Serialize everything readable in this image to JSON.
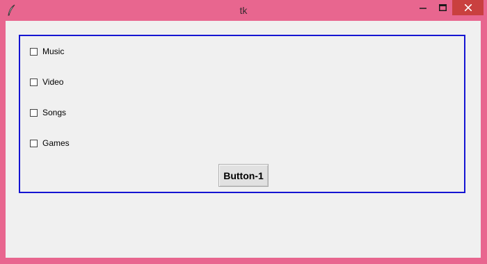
{
  "window": {
    "title": "tk",
    "icons": {
      "app": "feather-icon",
      "minimize": "minimize-icon",
      "maximize": "maximize-icon",
      "close": "close-icon"
    },
    "colors": {
      "titlebar": "#e8668f",
      "close_button": "#c9403f",
      "frame_border": "#1414d2",
      "client_background": "#f0f0f0"
    }
  },
  "checkboxes": [
    {
      "label": "Music",
      "checked": false
    },
    {
      "label": "Video",
      "checked": false
    },
    {
      "label": "Songs",
      "checked": false
    },
    {
      "label": "Games",
      "checked": false
    }
  ],
  "button": {
    "label": "Button-1"
  }
}
